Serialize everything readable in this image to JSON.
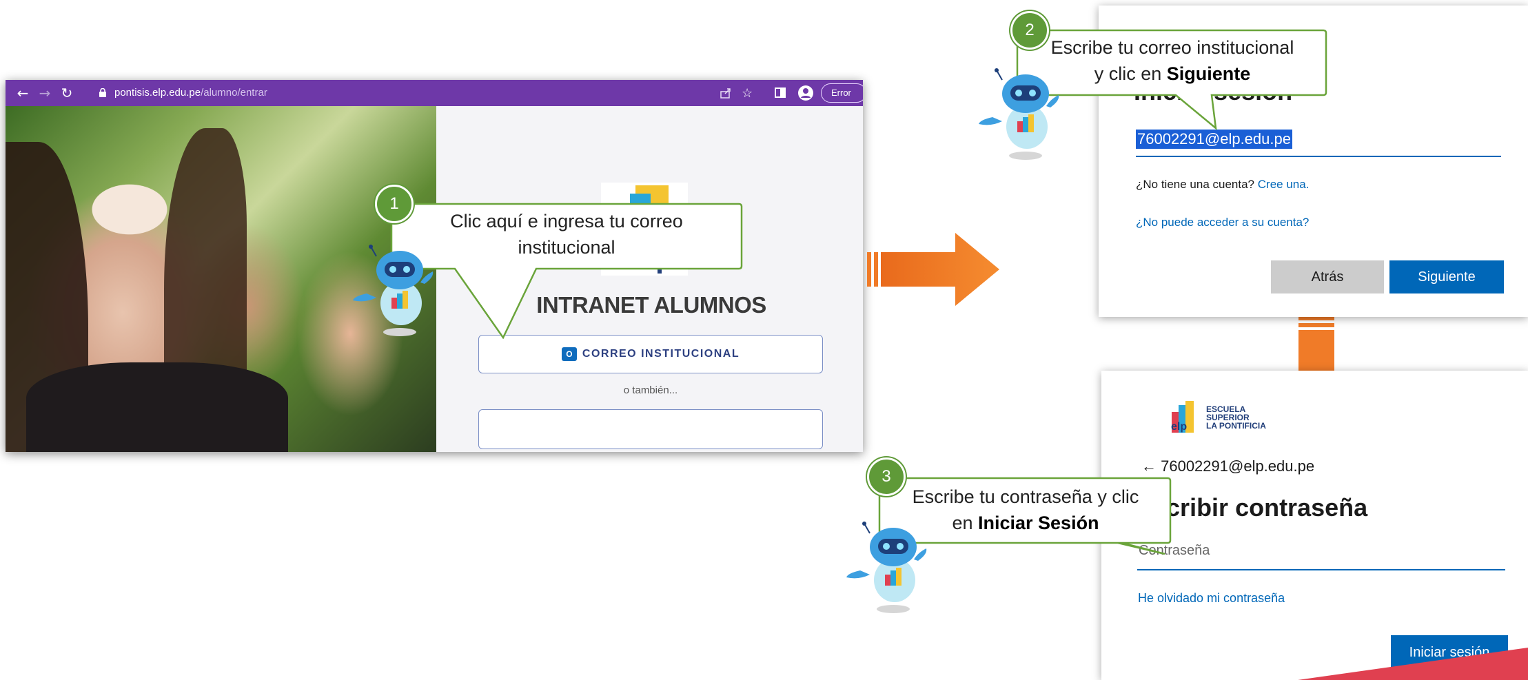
{
  "browser": {
    "url_host": "pontisis.elp.edu.pe",
    "url_path": "/alumno/entrar",
    "error_label": "Error",
    "icons": [
      "back-icon",
      "forward-icon",
      "reload-icon",
      "lock-icon",
      "share-icon",
      "star-icon",
      "sidepanel-icon",
      "profile-icon"
    ]
  },
  "intranet": {
    "title": "INTRANET ALUMNOS",
    "correo_button": "CORREO INSTITUCIONAL",
    "outlook_icon_text": "O",
    "also_text": "o también..."
  },
  "signin_email": {
    "heading": "Iniciar sesión",
    "email_value": "76002291@elp.edu.pe",
    "no_account_text": "¿No tiene una cuenta?",
    "create_link": "Cree una.",
    "cant_access_link": "¿No puede acceder a su cuenta?",
    "back_button": "Atrás",
    "next_button": "Siguiente"
  },
  "signin_password": {
    "org_name_1": "ESCUELA",
    "org_name_2": "SUPERIOR",
    "org_name_3": "LA PONTIFICIA",
    "back_email": "← 76002291@elp.edu.pe",
    "heading": "Escribir contraseña",
    "password_placeholder": "Contraseña",
    "forgot_link": "He olvidado mi contraseña",
    "signin_button": "Iniciar sesión"
  },
  "callouts": [
    {
      "number": "1",
      "line1": "Clic aquí e ingresa tu correo",
      "line2": "institucional"
    },
    {
      "number": "2",
      "line1": "Escribe tu correo institucional",
      "line2_prefix": "y clic en ",
      "line2_bold": "Siguiente"
    },
    {
      "number": "3",
      "line1": "Escribe tu contraseña y clic",
      "line2_prefix": "en ",
      "line2_bold": "Iniciar Sesión"
    }
  ],
  "colors": {
    "browser_bar": "#6e38a8",
    "callout_green": "#5f9a38",
    "arrow_orange": "#f07b28",
    "ms_blue": "#0067b8"
  }
}
